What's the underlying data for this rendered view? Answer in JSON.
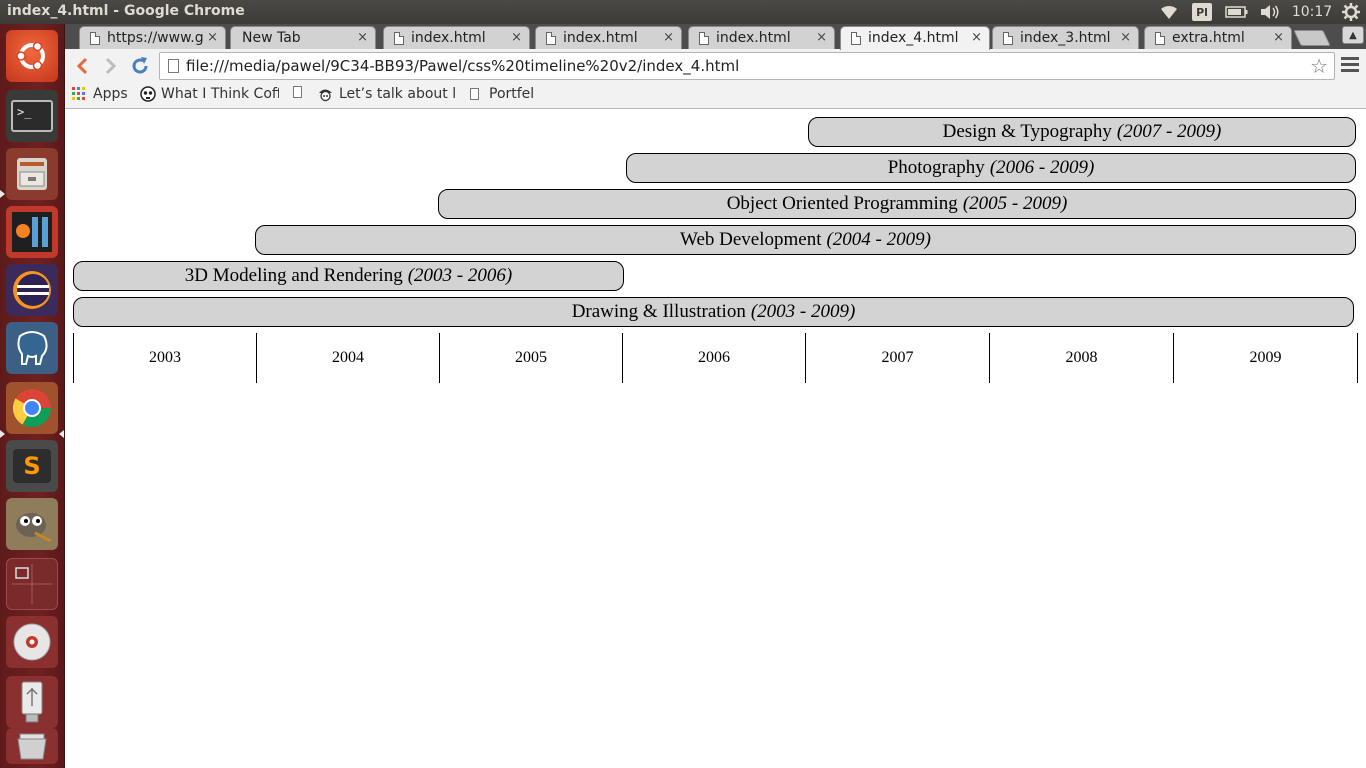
{
  "top_panel": {
    "window_title": "index_4.html - Google Chrome",
    "keyboard_layout": "Pl",
    "clock": "10:17",
    "indicators": [
      "wifi-icon",
      "keyboard-icon",
      "battery-icon",
      "volume-icon",
      "clock",
      "settings-gear-icon"
    ]
  },
  "launcher": {
    "items": [
      {
        "name": "ubuntu-dash",
        "icon": "ubuntu-logo-icon"
      },
      {
        "name": "terminal",
        "icon": "terminal-icon"
      },
      {
        "name": "files",
        "icon": "file-cabinet-icon"
      },
      {
        "name": "jetbrains",
        "icon": "jetbrains-icon"
      },
      {
        "name": "eclipse",
        "icon": "eclipse-icon"
      },
      {
        "name": "pgadmin",
        "icon": "postgres-elephant-icon"
      },
      {
        "name": "chrome",
        "icon": "chrome-icon"
      },
      {
        "name": "sublime-text",
        "icon": "sublime-text-icon"
      },
      {
        "name": "gimp",
        "icon": "gimp-icon"
      },
      {
        "name": "workspace-switcher",
        "icon": "workspaces-icon"
      },
      {
        "name": "dvd",
        "icon": "disc-icon"
      },
      {
        "name": "usb-drive",
        "icon": "usb-icon"
      },
      {
        "name": "trash",
        "icon": "trash-icon"
      }
    ]
  },
  "tabs": [
    {
      "label": "https://www.g",
      "active": false
    },
    {
      "label": "New Tab",
      "active": false
    },
    {
      "label": "index.html",
      "active": false
    },
    {
      "label": "index.html",
      "active": false
    },
    {
      "label": "index.html",
      "active": false
    },
    {
      "label": "index_4.html",
      "active": true
    },
    {
      "label": "index_3.html",
      "active": false
    },
    {
      "label": "extra.html",
      "active": false
    }
  ],
  "tab_close_glyph": "×",
  "toolbar": {
    "back_icon": "back-arrow-icon",
    "forward_icon": "forward-arrow-icon",
    "reload_icon": "reload-icon",
    "url": "file:///media/pawel/9C34-BB93/Pawel/css%20timeline%20v2/index_4.html",
    "star_glyph": "☆"
  },
  "bookmarks": [
    {
      "label": "Apps",
      "icon": "apps-grid-icon"
    },
    {
      "label": "What I Think Coff",
      "icon": "skull-icon"
    },
    {
      "label": "",
      "icon": "page-icon"
    },
    {
      "label": "Let’s talk about lo",
      "icon": "pirate-icon"
    },
    {
      "label": "Portfel",
      "icon": "page-icon"
    }
  ],
  "timeline": {
    "bars": [
      {
        "title": "Design & Typography",
        "range": "(2007 - 2009)",
        "start": 2007,
        "end": 2009
      },
      {
        "title": "Photography",
        "range": "(2006 - 2009)",
        "start": 2006,
        "end": 2009
      },
      {
        "title": "Object Oriented Programming",
        "range": "(2005 - 2009)",
        "start": 2005,
        "end": 2009
      },
      {
        "title": "Web Development",
        "range": "(2004 - 2009)",
        "start": 2004,
        "end": 2009
      },
      {
        "title": "3D Modeling and Rendering",
        "range": "(2003 - 2006)",
        "start": 2003,
        "end": 2006
      },
      {
        "title": "Drawing & Illustration",
        "range": "(2003 - 2009)",
        "start": 2003,
        "end": 2009
      }
    ],
    "years": [
      "2003",
      "2004",
      "2005",
      "2006",
      "2007",
      "2008",
      "2009"
    ]
  }
}
